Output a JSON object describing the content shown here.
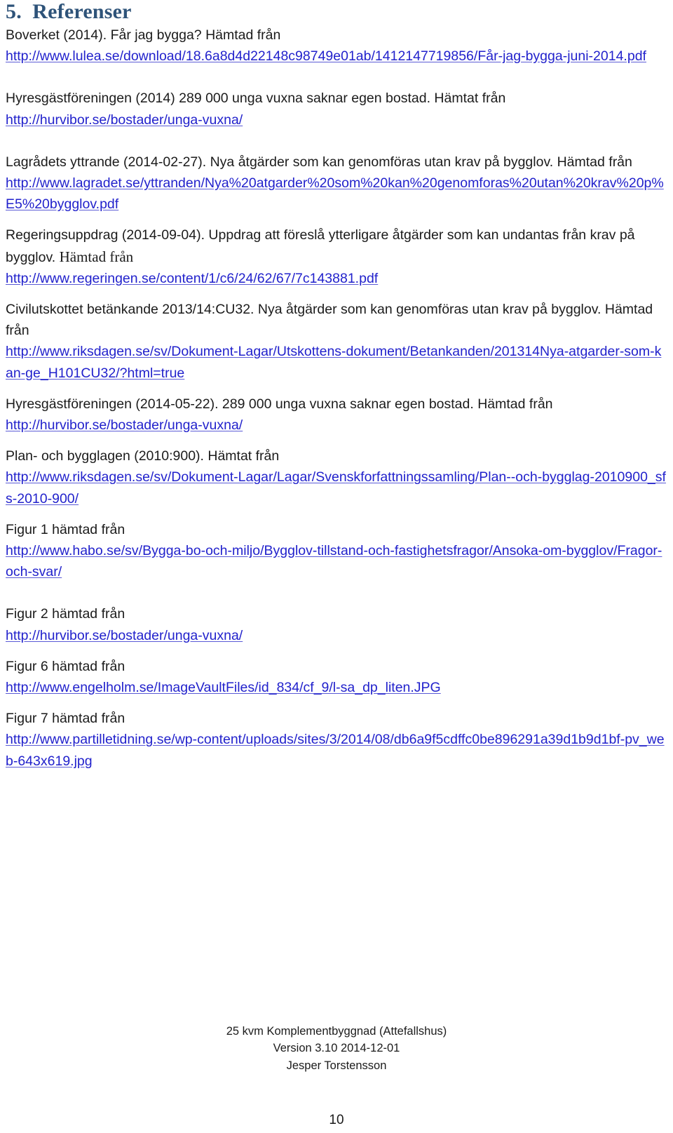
{
  "document": {
    "heading": "5.  Referenser",
    "heading_color": "#2E5379",
    "link_color": "#2222CC",
    "text_color": "#1B1B1B"
  },
  "references": [
    {
      "id": "boverket",
      "text_before": "Boverket (2014). Får jag bygga? Hämtad från",
      "url": "http://www.lulea.se/download/18.6a8d4d22148c98749e01ab/1412147719856/Får-jag-bygga-juni-2014.pdf"
    },
    {
      "id": "hyresgastforeningen-2014",
      "text_before": "Hyresgästföreningen (2014) 289 000 unga vuxna saknar egen bostad. Hämtat från",
      "url": "http://hurvibor.se/bostader/unga-vuxna/"
    },
    {
      "id": "lagradets-yttrande",
      "text_before": "Lagrådets yttrande (2014-02-27). Nya åtgärder som kan genomföras utan krav på bygglov. Hämtad från",
      "url": "http://www.lagradet.se/yttranden/Nya%20atgarder%20som%20kan%20genomforas%20utan%20krav%20p%E5%20bygglov.pdf"
    },
    {
      "id": "regeringsuppdrag",
      "text_before": "Regeringsuppdrag (2014-09-04). Uppdrag att föreslå ytterligare åtgärder som kan undantas från krav på bygglov.",
      "text_before_serif": "Hämtad från",
      "url": "http://www.regeringen.se/content/1/c6/24/62/67/7c143881.pdf"
    },
    {
      "id": "civilutskottet",
      "text_before": "Civilutskottet betänkande 2013/14:CU32. Nya åtgärder som kan genomföras utan krav på bygglov. Hämtad från",
      "url": "http://www.riksdagen.se/sv/Dokument-Lagar/Utskottens-dokument/Betankanden/201314Nya-atgarder-som-kan-ge_H101CU32/?html=true"
    },
    {
      "id": "hyresgastforeningen-2014-05-22",
      "text_before": "Hyresgästföreningen (2014-05-22). 289 000 unga vuxna saknar egen bostad. Hämtad från",
      "url": "http://hurvibor.se/bostader/unga-vuxna/"
    },
    {
      "id": "plan-och-bygglagen",
      "text_before": "Plan- och bygglagen (2010:900). Hämtat från",
      "url": "http://www.riksdagen.se/sv/Dokument-Lagar/Lagar/Svenskforfattningssamling/Plan--och-bygglag-2010900_sfs-2010-900/"
    },
    {
      "id": "figur-1",
      "text_before": "Figur 1 hämtad från",
      "url": "http://www.habo.se/sv/Bygga-bo-och-miljo/Bygglov-tillstand-och-fastighetsfragor/Ansoka-om-bygglov/Fragor-och-svar/"
    },
    {
      "id": "figur-2",
      "text_before": "Figur 2 hämtad från",
      "url": "http://hurvibor.se/bostader/unga-vuxna/"
    },
    {
      "id": "figur-6",
      "text_before": "Figur 6 hämtad från",
      "url": "http://www.engelholm.se/ImageVaultFiles/id_834/cf_9/l-sa_dp_liten.JPG"
    },
    {
      "id": "figur-7",
      "text_before": "Figur 7 hämtad från",
      "url": "http://www.partilletidning.se/wp-content/uploads/sites/3/2014/08/db6a9f5cdffc0be896291a39d1b9d1bf-pv_web-643x619.jpg"
    }
  ],
  "footer": {
    "line1": "25 kvm Komplementbyggnad (Attefallshus)",
    "line2": "Version 3.10 2014-12-01",
    "line3": "Jesper Torstensson",
    "page_number": "10"
  }
}
